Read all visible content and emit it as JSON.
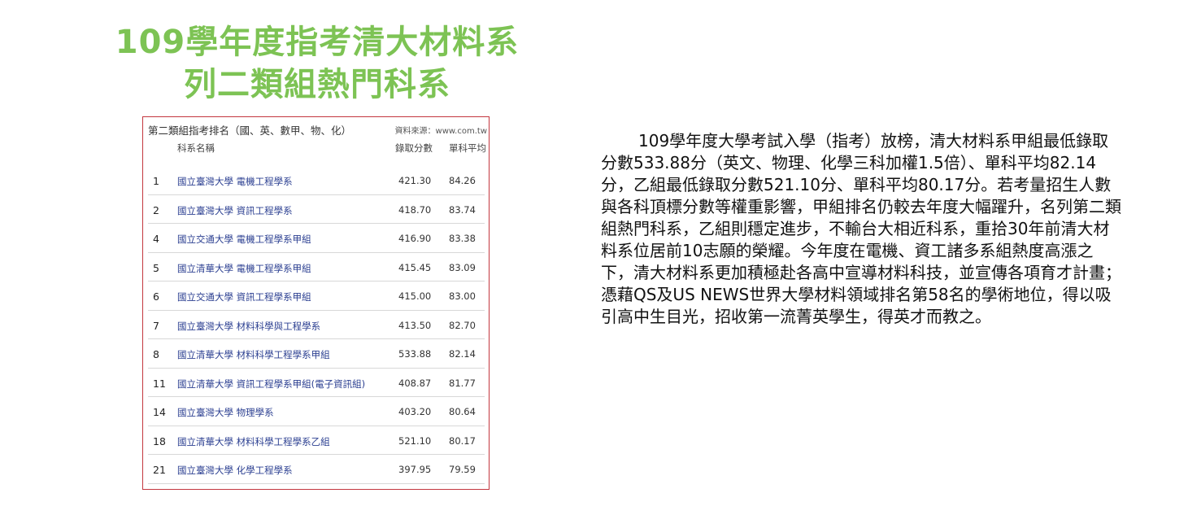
{
  "title": {
    "line1": "109學年度指考清大材料系",
    "line2": "列二類組熱門科系"
  },
  "table": {
    "caption": "第二類組指考排名（國、英、數甲、物、化）",
    "source": "資料來源：www.com.tw",
    "headers": {
      "name": "科系名稱",
      "score": "錄取分數",
      "avg": "單科平均"
    },
    "rows": [
      {
        "rank": "1",
        "dept": "國立臺灣大學 電機工程學系",
        "score": "421.30",
        "avg": "84.26"
      },
      {
        "rank": "2",
        "dept": "國立臺灣大學 資訊工程學系",
        "score": "418.70",
        "avg": "83.74"
      },
      {
        "rank": "4",
        "dept": "國立交通大學 電機工程學系甲組",
        "score": "416.90",
        "avg": "83.38"
      },
      {
        "rank": "5",
        "dept": "國立清華大學 電機工程學系甲組",
        "score": "415.45",
        "avg": "83.09"
      },
      {
        "rank": "6",
        "dept": "國立交通大學 資訊工程學系甲組",
        "score": "415.00",
        "avg": "83.00"
      },
      {
        "rank": "7",
        "dept": "國立臺灣大學 材料科學與工程學系",
        "score": "413.50",
        "avg": "82.70"
      },
      {
        "rank": "8",
        "dept": "國立清華大學 材料科學工程學系甲組",
        "score": "533.88",
        "avg": "82.14"
      },
      {
        "rank": "11",
        "dept": "國立清華大學 資訊工程學系甲組(電子資訊組)",
        "score": "408.87",
        "avg": "81.77"
      },
      {
        "rank": "14",
        "dept": "國立臺灣大學 物理學系",
        "score": "403.20",
        "avg": "80.64"
      },
      {
        "rank": "18",
        "dept": "國立清華大學 材料科學工程學系乙組",
        "score": "521.10",
        "avg": "80.17"
      },
      {
        "rank": "21",
        "dept": "國立臺灣大學 化學工程學系",
        "score": "397.95",
        "avg": "79.59"
      }
    ]
  },
  "paragraph": "109學年度大學考試入學（指考）放榜，清大材料系甲組最低錄取分數533.88分（英文、物理、化學三科加權1.5倍）、單科平均82.14分，乙組最低錄取分數521.10分、單科平均80.17分。若考量招生人數與各科頂標分數等權重影響，甲組排名仍較去年度大幅躍升，名列第二類組熱門科系，乙組則穩定進步，不輸台大相近科系，重拾30年前清大材料系位居前10志願的榮耀。今年度在電機、資工諸多系組熱度高漲之下，清大材料系更加積極赴各高中宣導材料科技，並宣傳各項育才計畫；憑藉QS及US NEWS世界大學材料領域排名第58名的學術地位，得以吸引高中生目光，招收第一流菁英學生，得英才而教之。",
  "colors": {
    "title": "#7dc354",
    "table_border": "#c3373f",
    "dept_text": "#2b3f91"
  }
}
